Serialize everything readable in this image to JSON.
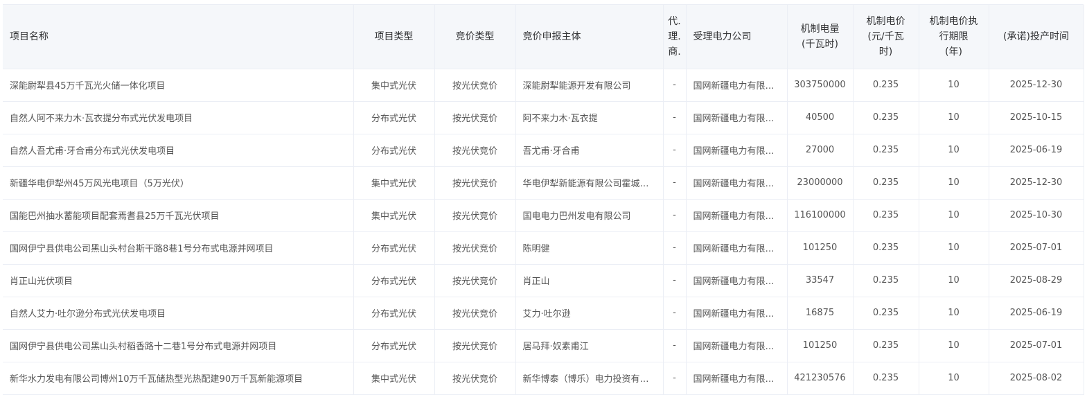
{
  "table": {
    "headers": {
      "name": "项目名称",
      "project_type": "项目类型",
      "bid_type": "竞价类型",
      "bid_entity": "竞价申报主体",
      "agent": "代理商",
      "power_company": "受理电力公司",
      "volume_l1": "机制电量",
      "volume_l2": "(千瓦时)",
      "price_l1": "机制电价",
      "price_l2": "(元/千瓦",
      "price_l3": "时)",
      "period_l1": "机制电价执",
      "period_l2": "行期限",
      "period_l3": "(年)",
      "date": "(承诺)投产时间"
    },
    "rows": [
      {
        "name": "深能尉犁县45万千瓦光火储一体化项目",
        "project_type": "集中式光伏",
        "bid_type": "按光伏竞价",
        "bid_entity": "深能尉犁能源开发有限公司",
        "agent": "-",
        "power_company": "国网新疆电力有限公司",
        "volume": "303750000",
        "price": "0.235",
        "period": "10",
        "date": "2025-12-30"
      },
      {
        "name": "自然人阿不来力木·瓦衣提分布式光伏发电项目",
        "project_type": "分布式光伏",
        "bid_type": "按光伏竞价",
        "bid_entity": "阿不来力木·瓦衣提",
        "agent": "-",
        "power_company": "国网新疆电力有限公司",
        "volume": "40500",
        "price": "0.235",
        "period": "10",
        "date": "2025-10-15"
      },
      {
        "name": "自然人吾尤甫·牙合甫分布式光伏发电项目",
        "project_type": "分布式光伏",
        "bid_type": "按光伏竞价",
        "bid_entity": "吾尤甫·牙合甫",
        "agent": "-",
        "power_company": "国网新疆电力有限公司",
        "volume": "27000",
        "price": "0.235",
        "period": "10",
        "date": "2025-06-19"
      },
      {
        "name": "新疆华电伊犁州45万风光电项目（5万光伏）",
        "project_type": "集中式光伏",
        "bid_type": "按光伏竞价",
        "bid_entity": "华电伊犁新能源有限公司霍城分公司",
        "agent": "-",
        "power_company": "国网新疆电力有限公司",
        "volume": "23000000",
        "price": "0.235",
        "period": "10",
        "date": "2025-12-30"
      },
      {
        "name": "国能巴州抽水蓄能项目配套焉耆县25万千瓦光伏项目",
        "project_type": "集中式光伏",
        "bid_type": "按光伏竞价",
        "bid_entity": "国电电力巴州发电有限公司",
        "agent": "-",
        "power_company": "国网新疆电力有限公司",
        "volume": "116100000",
        "price": "0.235",
        "period": "10",
        "date": "2025-10-30"
      },
      {
        "name": "国网伊宁县供电公司黑山头村台斯干路8巷1号分布式电源并网项目",
        "project_type": "分布式光伏",
        "bid_type": "按光伏竞价",
        "bid_entity": "陈明健",
        "agent": "-",
        "power_company": "国网新疆电力有限公司",
        "volume": "101250",
        "price": "0.235",
        "period": "10",
        "date": "2025-07-01"
      },
      {
        "name": "肖正山光伏项目",
        "project_type": "分布式光伏",
        "bid_type": "按光伏竞价",
        "bid_entity": "肖正山",
        "agent": "-",
        "power_company": "国网新疆电力有限公司",
        "volume": "33547",
        "price": "0.235",
        "period": "10",
        "date": "2025-08-29"
      },
      {
        "name": "自然人艾力·吐尔逊分布式光伏发电项目",
        "project_type": "分布式光伏",
        "bid_type": "按光伏竞价",
        "bid_entity": "艾力·吐尔逊",
        "agent": "-",
        "power_company": "国网新疆电力有限公司",
        "volume": "16875",
        "price": "0.235",
        "period": "10",
        "date": "2025-06-19"
      },
      {
        "name": "国网伊宁县供电公司黑山头村稻香路十二巷1号分布式电源并网项目",
        "project_type": "分布式光伏",
        "bid_type": "按光伏竞价",
        "bid_entity": "居马拜·奴素甫江",
        "agent": "-",
        "power_company": "国网新疆电力有限公司",
        "volume": "101250",
        "price": "0.235",
        "period": "10",
        "date": "2025-07-01"
      },
      {
        "name": "新华水力发电有限公司博州10万千瓦储热型光热配建90万千瓦新能源项目",
        "project_type": "集中式光伏",
        "bid_type": "按光伏竞价",
        "bid_entity": "新华博泰（博乐）电力投资有限公司",
        "agent": "-",
        "power_company": "国网新疆电力有限公司",
        "volume": "421230576",
        "price": "0.235",
        "period": "10",
        "date": "2025-08-02"
      }
    ]
  }
}
